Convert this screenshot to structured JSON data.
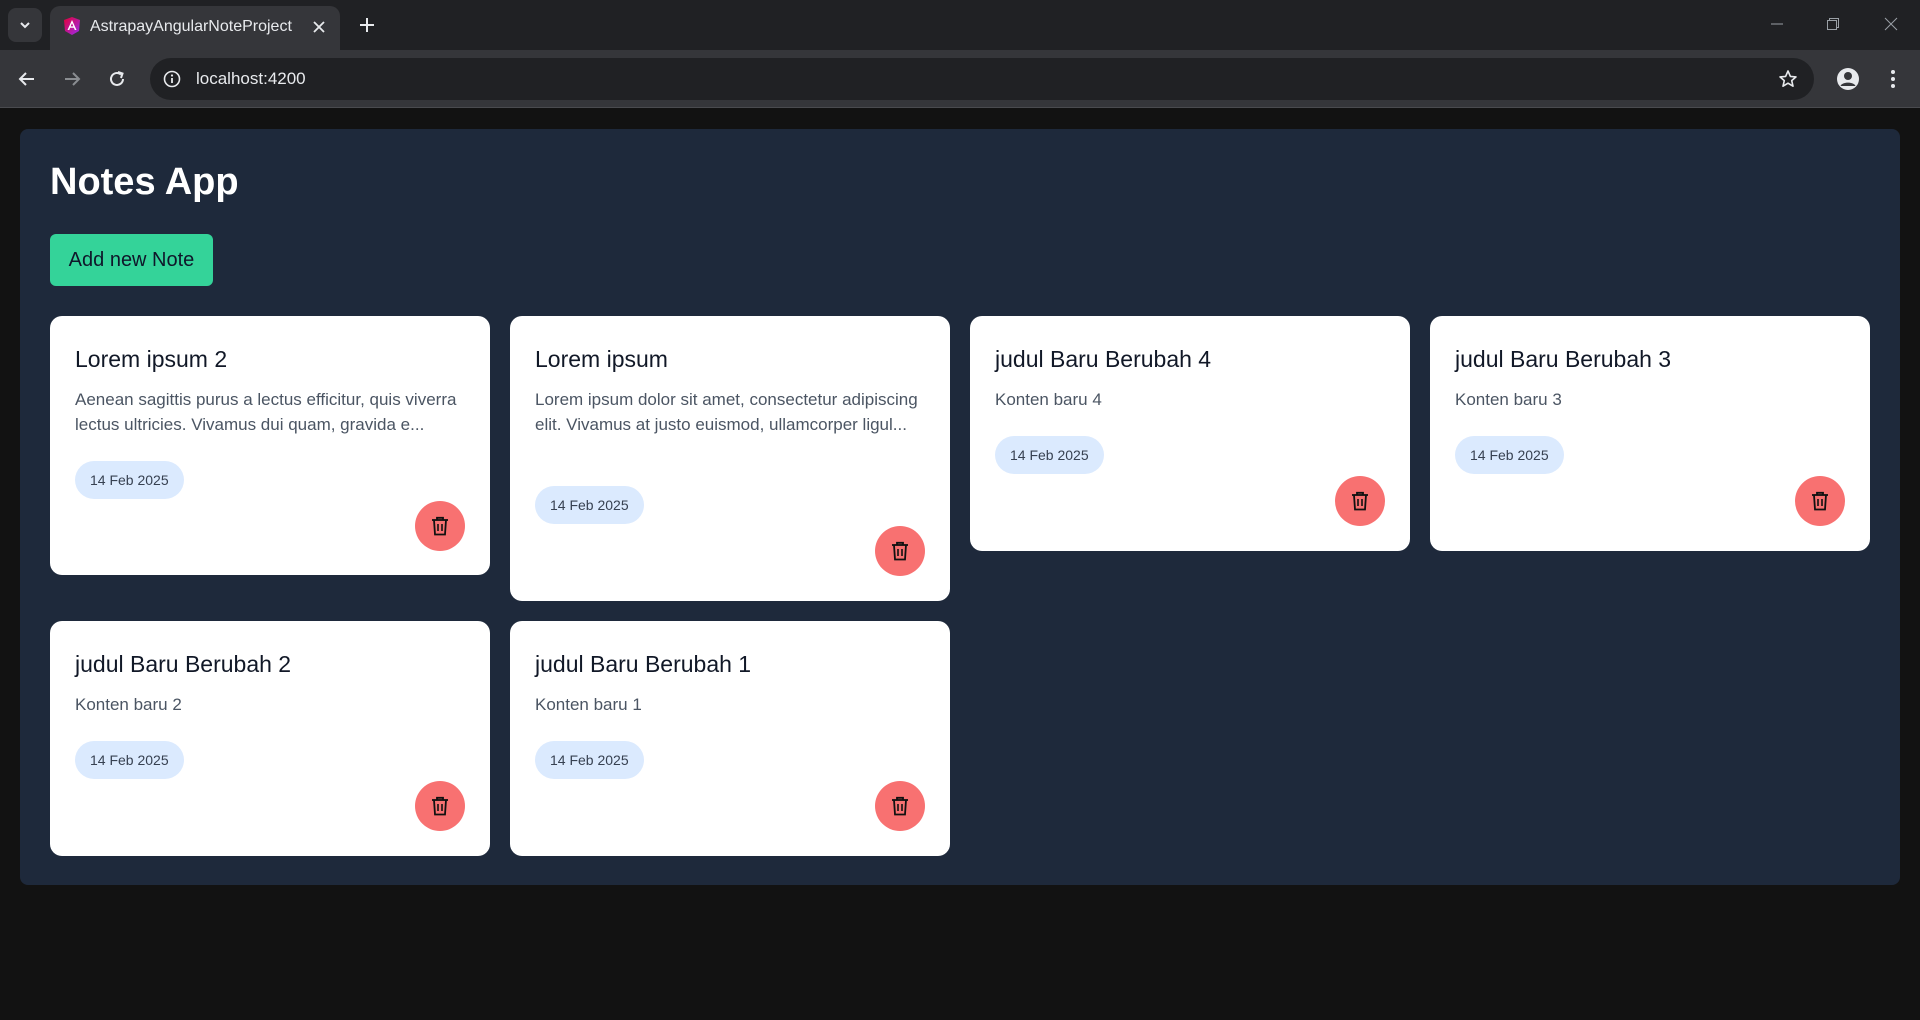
{
  "browser": {
    "tab_title": "AstrapayAngularNoteProject",
    "url": "localhost:4200"
  },
  "app": {
    "title": "Notes App",
    "add_button_label": "Add new Note"
  },
  "notes": [
    {
      "title": "Lorem ipsum 2",
      "content": "Aenean sagittis purus a lectus efficitur, quis viverra lectus ultricies. Vivamus dui quam, gravida e...",
      "date": "14 Feb 2025"
    },
    {
      "title": "Lorem ipsum",
      "content": "Lorem ipsum dolor sit amet, consectetur adipiscing elit. Vivamus at justo euismod, ullamcorper ligul...",
      "date": "14 Feb 2025"
    },
    {
      "title": "judul Baru Berubah 4",
      "content": "Konten baru 4",
      "date": "14 Feb 2025"
    },
    {
      "title": "judul Baru Berubah 3",
      "content": "Konten baru 3",
      "date": "14 Feb 2025"
    },
    {
      "title": "judul Baru Berubah 2",
      "content": "Konten baru 2",
      "date": "14 Feb 2025"
    },
    {
      "title": "judul Baru Berubah 1",
      "content": "Konten baru 1",
      "date": "14 Feb 2025"
    }
  ],
  "colors": {
    "page_bg": "#1e293b",
    "accent": "#34d399",
    "delete": "#f87171",
    "badge": "#dbeafe"
  }
}
